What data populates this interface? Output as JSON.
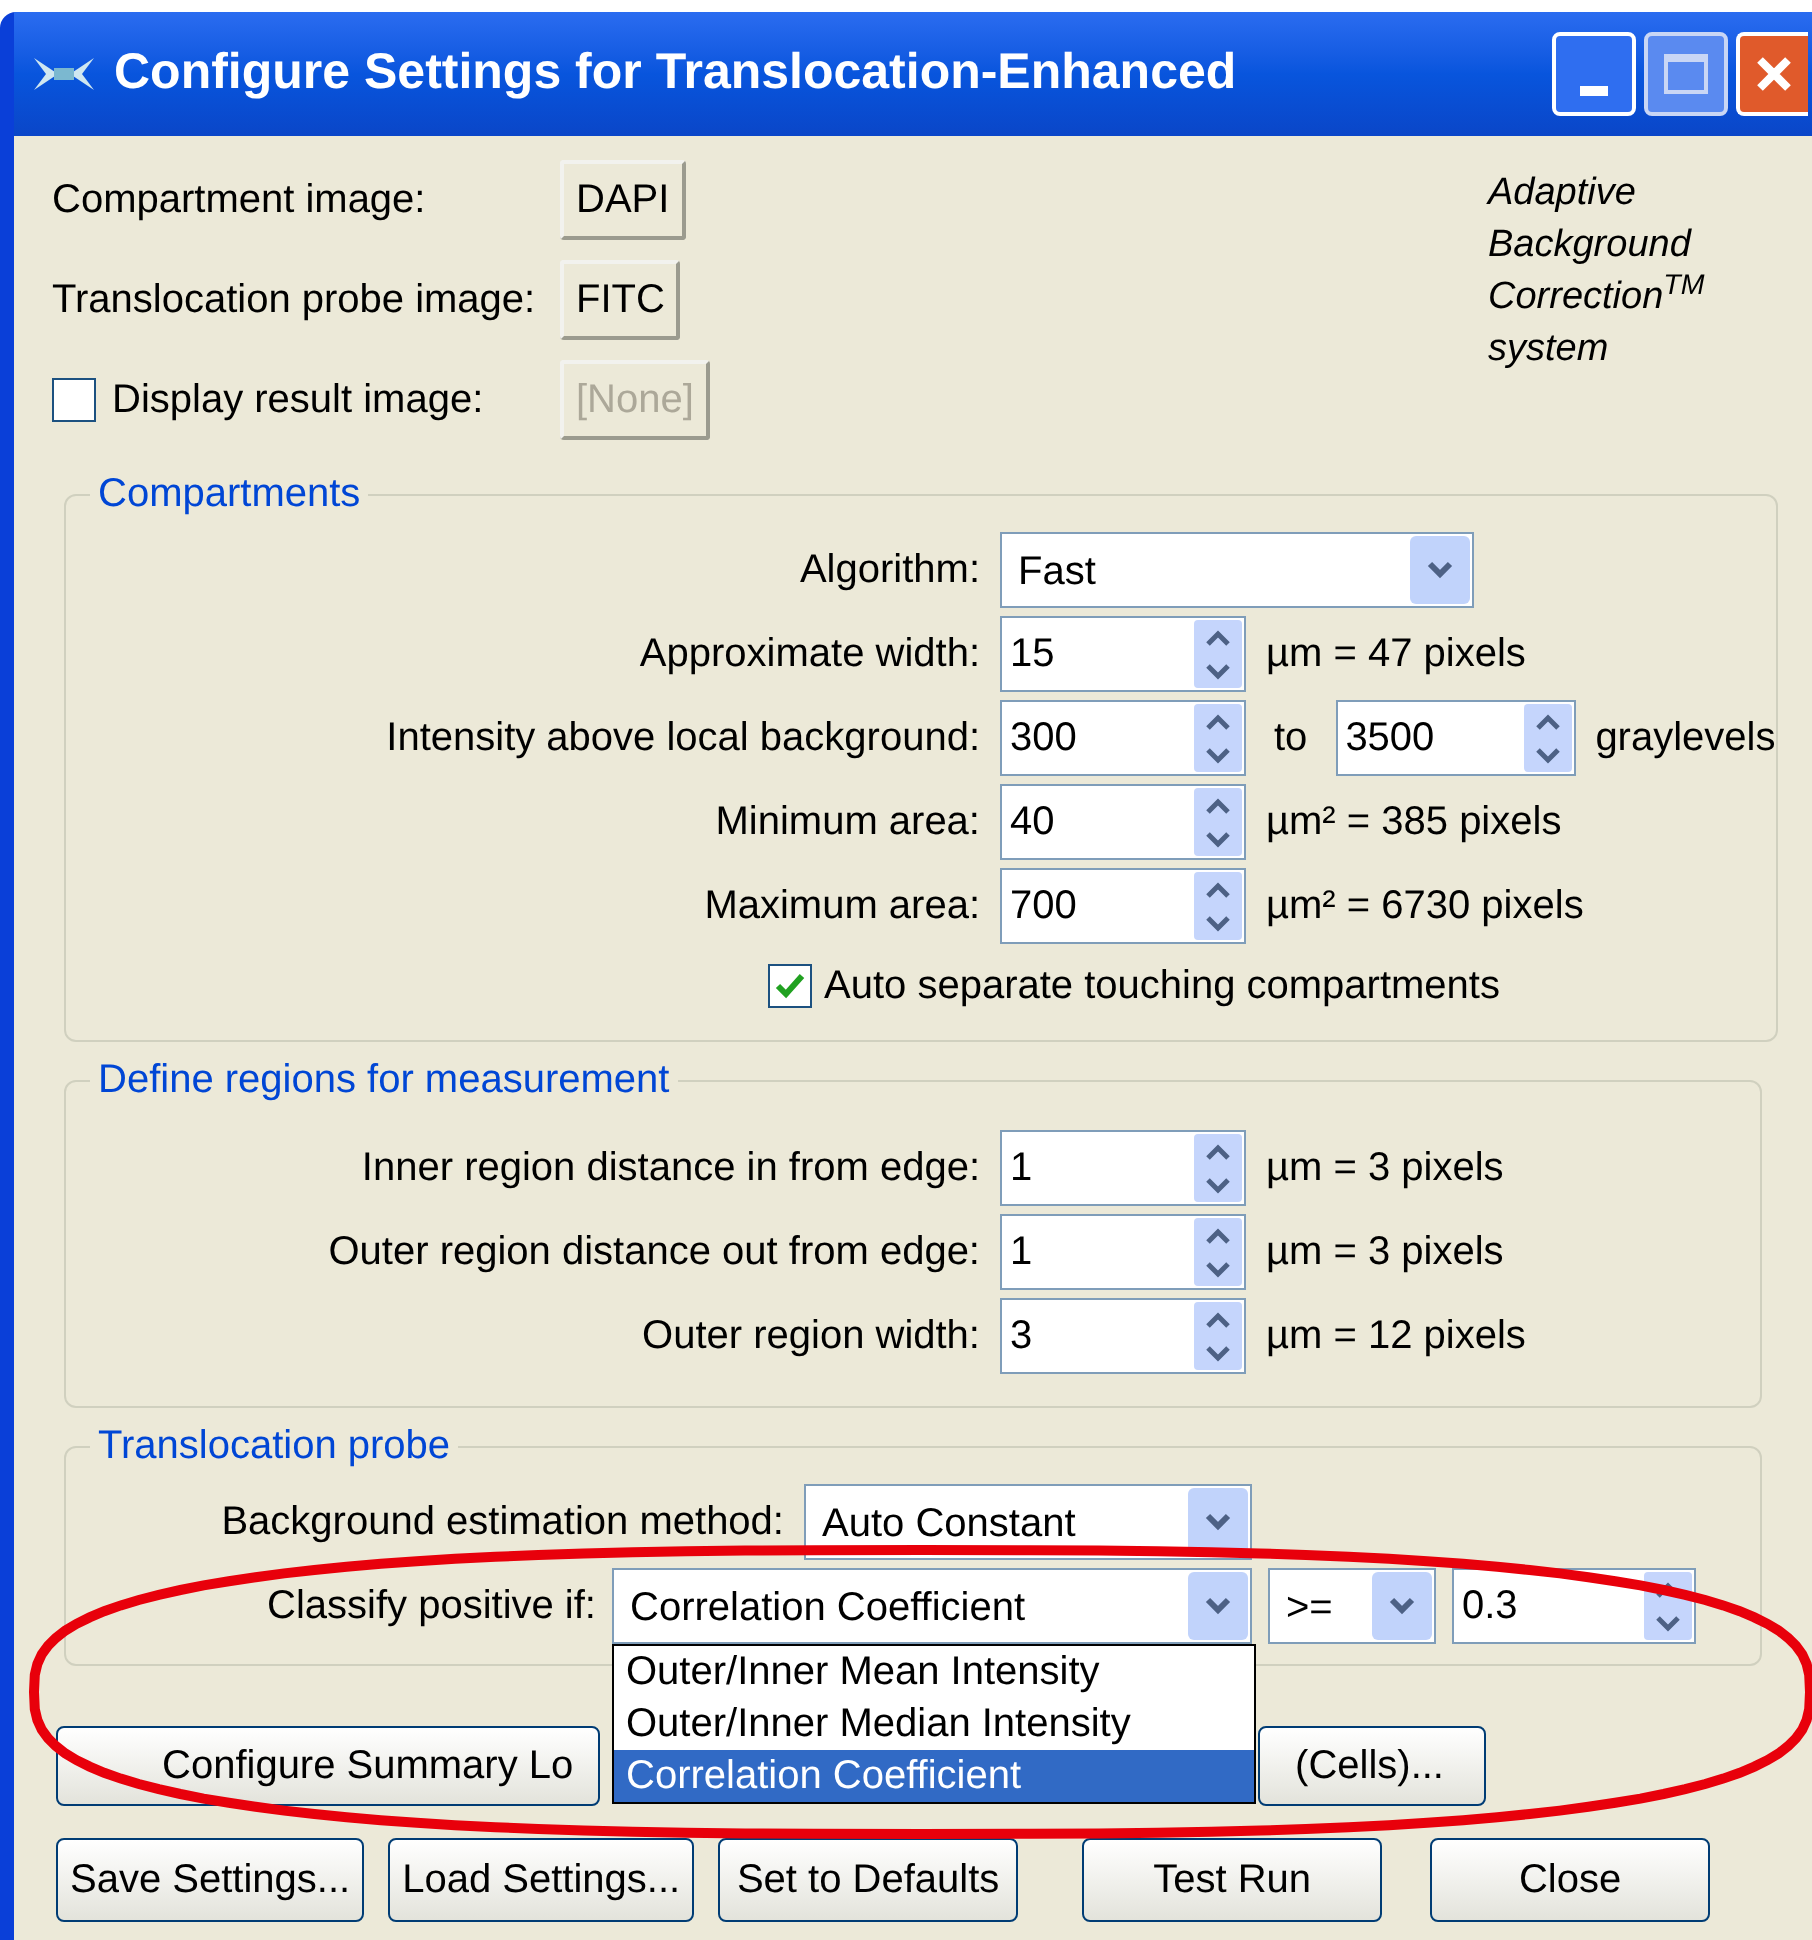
{
  "window": {
    "title": "Configure Settings for Translocation-Enhanced"
  },
  "images": [
    {
      "kind": "button",
      "label": "Compartment image:",
      "value": "DAPI",
      "disabled": false
    },
    {
      "kind": "button",
      "label": "Translocation probe image:",
      "value": "FITC",
      "disabled": false
    },
    {
      "kind": "checkbox",
      "label": "Display result image:",
      "checked": false,
      "value": "[None]",
      "disabled": true
    }
  ],
  "branding": [
    "Adaptive",
    "Background",
    "Correction$^{TM}$",
    "system"
  ],
  "compartments": {
    "title": "Compartments",
    "rows": [
      {
        "kind": "dropdown",
        "label": "Algorithm:",
        "value": "Fast"
      },
      {
        "kind": "spinner",
        "label": "Approximate width:",
        "value": "15",
        "unit": "µm = 47 pixels"
      },
      {
        "kind": "range",
        "label": "Intensity above local background:",
        "value": "300",
        "to": "to",
        "value2": "3500",
        "unit": "graylevels"
      },
      {
        "kind": "spinner",
        "label": "Minimum area:",
        "value": "40",
        "unit": "µm² = 385 pixels"
      },
      {
        "kind": "spinner",
        "label": "Maximum area:",
        "value": "700",
        "unit": "µm² = 6730 pixels"
      }
    ],
    "checkbox": {
      "label": "Auto separate touching compartments",
      "checked": true
    }
  },
  "regions": {
    "title": "Define regions for measurement",
    "rows": [
      {
        "kind": "spinner",
        "label": "Inner region distance in from edge:",
        "value": "1",
        "unit": "µm = 3 pixels"
      },
      {
        "kind": "spinner",
        "label": "Outer region distance out from edge:",
        "value": "1",
        "unit": "µm = 3 pixels"
      },
      {
        "kind": "spinner",
        "label": "Outer region width:",
        "value": "3",
        "unit": "µm = 12 pixels"
      }
    ]
  },
  "probe": {
    "title": "Translocation probe",
    "background": {
      "label": "Background estimation method:",
      "value": "Auto Constant"
    },
    "classify": {
      "label": "Classify positive if:",
      "value": "Correlation Coefficient",
      "operator": ">=",
      "threshold": "0.3",
      "expanded": true,
      "options": [
        {
          "label": "Outer/Inner Mean Intensity",
          "selected": false
        },
        {
          "label": "Outer/Inner Median Intensity",
          "selected": false
        },
        {
          "label": "Correlation Coefficient",
          "selected": true
        }
      ]
    }
  },
  "log_buttons": [
    "Configure Summary Lo",
    "(Cells)..."
  ],
  "buttons": [
    "Save Settings...",
    "Load Settings...",
    "Set to Defaults",
    "Test Run",
    "Close"
  ]
}
